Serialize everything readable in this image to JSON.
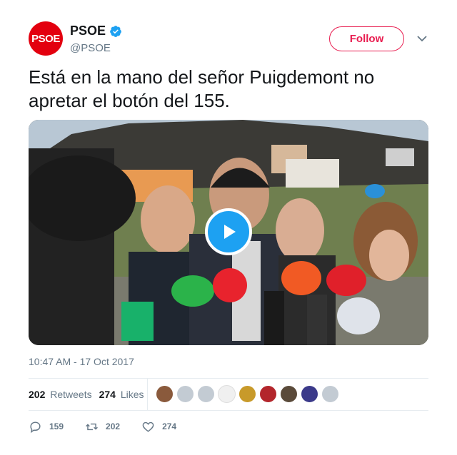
{
  "account": {
    "avatar_text": "PSOE",
    "display_name": "PSOE",
    "handle": "@PSOE",
    "verified": true,
    "brand_color": "#e3000f"
  },
  "follow_button": {
    "label": "Follow",
    "color": "#e81c4f"
  },
  "menu_icon": "chevron-down-icon",
  "tweet": {
    "text": "Está en la mano del señor Puigdemont no apretar el botón del 155.",
    "media_type": "video",
    "timestamp": "10:47 AM - 17 Oct 2017"
  },
  "stats": {
    "retweets_count": "202",
    "retweets_label": "Retweets",
    "likes_count": "274",
    "likes_label": "Likes"
  },
  "actions": {
    "reply_count": "159",
    "retweet_count": "202",
    "like_count": "274"
  },
  "colors": {
    "accent": "#1da1f2",
    "secondary_text": "#657786"
  }
}
